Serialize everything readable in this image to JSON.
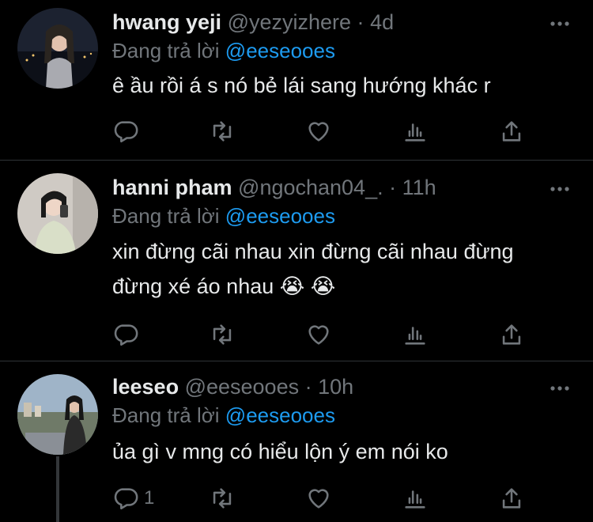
{
  "replies": [
    {
      "name": "hwang yeji",
      "handle": "@yezyizhere",
      "dot": "·",
      "time": "4d",
      "replying_prefix": "Đang trả lời",
      "mention": "@eeseooes",
      "text_lines": [
        "ê ầu rồi á s nó bẻ lái sang hướng khác r"
      ],
      "reply_count": ""
    },
    {
      "name": "hanni pham",
      "handle": "@ngochan04_.",
      "dot": "·",
      "time": "11h",
      "replying_prefix": "Đang trả lời",
      "mention": "@eeseooes",
      "text_lines": [
        "xin đừng cãi nhau xin đừng cãi nhau đừng",
        "đừng xé áo nhau 😭 😭"
      ],
      "reply_count": ""
    },
    {
      "name": "leeseo",
      "handle": "@eeseooes",
      "dot": "·",
      "time": "10h",
      "replying_prefix": "Đang trả lời",
      "mention": "@eeseooes",
      "text_lines": [
        "ủa gì v mng có hiểu lộn ý em nói ko"
      ],
      "reply_count": "1"
    }
  ],
  "icons": {
    "reply": "reply-icon",
    "retweet": "retweet-icon",
    "like": "heart-icon",
    "views": "views-icon",
    "share": "share-icon",
    "more": "more-icon"
  },
  "colors": {
    "background": "#000000",
    "text": "#e7e9ea",
    "muted": "#71767b",
    "mention": "#1d9bf0",
    "divider": "#2f3336"
  }
}
